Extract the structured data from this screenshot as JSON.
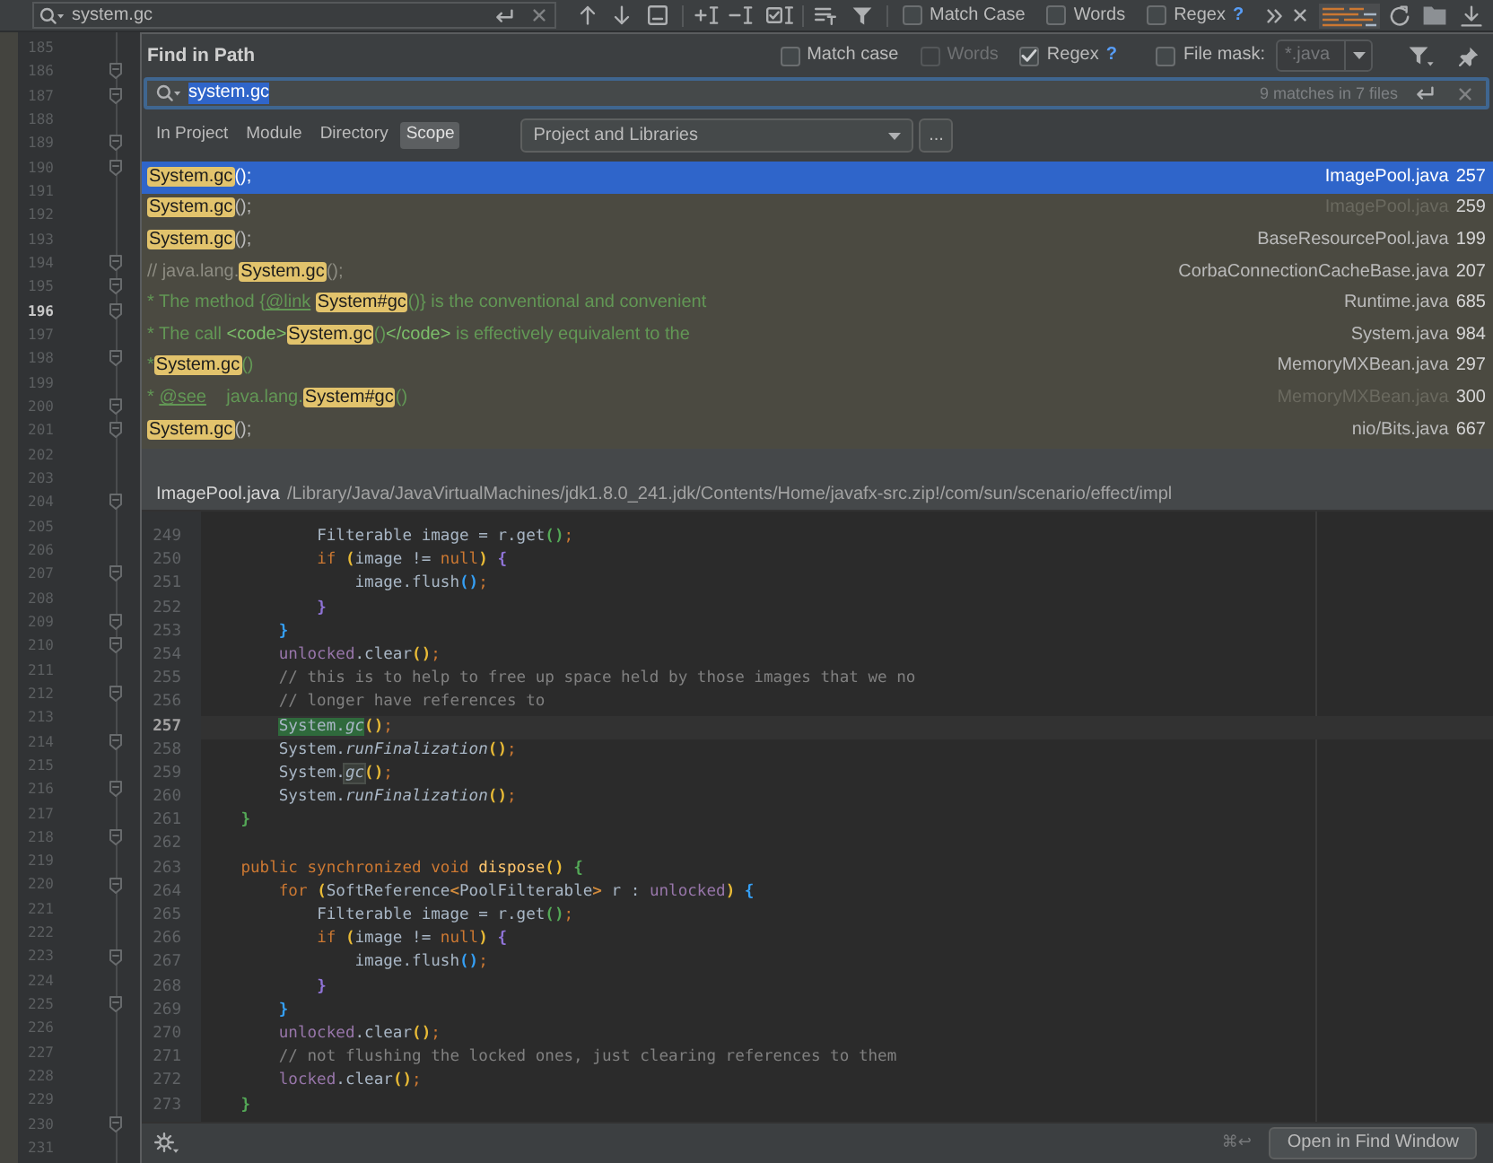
{
  "find_bar": {
    "query": "system.gc",
    "options": [
      {
        "label": "Match Case",
        "checked": false
      },
      {
        "label": "Words",
        "checked": false
      },
      {
        "label": "Regex",
        "checked": false,
        "help": "?"
      }
    ]
  },
  "editor_gutter": {
    "lines": [
      {
        "number": "185",
        "current": false,
        "fold": false
      },
      {
        "number": "186",
        "current": false,
        "fold": true
      },
      {
        "number": "187",
        "current": false,
        "fold": true
      },
      {
        "number": "188",
        "current": false,
        "fold": false
      },
      {
        "number": "189",
        "current": false,
        "fold": true
      },
      {
        "number": "190",
        "current": false,
        "fold": true
      },
      {
        "number": "191",
        "current": false,
        "fold": false
      },
      {
        "number": "192",
        "current": false,
        "fold": false
      },
      {
        "number": "193",
        "current": false,
        "fold": false
      },
      {
        "number": "194",
        "current": false,
        "fold": true
      },
      {
        "number": "195",
        "current": false,
        "fold": true
      },
      {
        "number": "196",
        "current": true,
        "fold": true
      },
      {
        "number": "197",
        "current": false,
        "fold": false
      },
      {
        "number": "198",
        "current": false,
        "fold": true
      },
      {
        "number": "199",
        "current": false,
        "fold": false
      },
      {
        "number": "200",
        "current": false,
        "fold": true
      },
      {
        "number": "201",
        "current": false,
        "fold": true
      },
      {
        "number": "202",
        "current": false,
        "fold": false
      },
      {
        "number": "203",
        "current": false,
        "fold": false
      },
      {
        "number": "204",
        "current": false,
        "fold": true
      },
      {
        "number": "205",
        "current": false,
        "fold": false
      },
      {
        "number": "206",
        "current": false,
        "fold": false
      },
      {
        "number": "207",
        "current": false,
        "fold": true
      },
      {
        "number": "208",
        "current": false,
        "fold": false
      },
      {
        "number": "209",
        "current": false,
        "fold": true
      },
      {
        "number": "210",
        "current": false,
        "fold": true
      },
      {
        "number": "211",
        "current": false,
        "fold": false
      },
      {
        "number": "212",
        "current": false,
        "fold": true
      },
      {
        "number": "213",
        "current": false,
        "fold": false
      },
      {
        "number": "214",
        "current": false,
        "fold": true
      },
      {
        "number": "215",
        "current": false,
        "fold": false
      },
      {
        "number": "216",
        "current": false,
        "fold": true
      },
      {
        "number": "217",
        "current": false,
        "fold": false
      },
      {
        "number": "218",
        "current": false,
        "fold": true
      },
      {
        "number": "219",
        "current": false,
        "fold": false
      },
      {
        "number": "220",
        "current": false,
        "fold": true
      },
      {
        "number": "221",
        "current": false,
        "fold": false
      },
      {
        "number": "222",
        "current": false,
        "fold": false
      },
      {
        "number": "223",
        "current": false,
        "fold": true
      },
      {
        "number": "224",
        "current": false,
        "fold": false
      },
      {
        "number": "225",
        "current": false,
        "fold": true
      },
      {
        "number": "226",
        "current": false,
        "fold": false
      },
      {
        "number": "227",
        "current": false,
        "fold": false
      },
      {
        "number": "228",
        "current": false,
        "fold": false
      },
      {
        "number": "229",
        "current": false,
        "fold": false
      },
      {
        "number": "230",
        "current": false,
        "fold": true
      },
      {
        "number": "231",
        "current": false,
        "fold": false
      }
    ]
  },
  "dialog": {
    "title": "Find in Path",
    "options": [
      {
        "label": "Match case",
        "checked": false,
        "disabled": false
      },
      {
        "label": "Words",
        "checked": false,
        "disabled": true
      },
      {
        "label": "Regex",
        "checked": true,
        "disabled": false,
        "help": "?"
      }
    ],
    "file_mask": {
      "label": "File mask:",
      "checked": false,
      "value": "*.java"
    },
    "search": {
      "query": "system.gc",
      "summary": "9 matches in 7 files"
    },
    "scope_tabs": [
      {
        "label": "In Project",
        "selected": false
      },
      {
        "label": "Module",
        "selected": false
      },
      {
        "label": "Directory",
        "selected": false
      },
      {
        "label": "Scope",
        "selected": true
      }
    ],
    "scope": "Project and Libraries",
    "browse_button": "...",
    "results": [
      {
        "segments": [
          {
            "text": "System.gc",
            "kind": "match"
          },
          {
            "text": "();",
            "kind": "code"
          }
        ],
        "file": "ImagePool.java",
        "line": "257",
        "selected": true,
        "file_dimmed": false
      },
      {
        "segments": [
          {
            "text": "System.gc",
            "kind": "match"
          },
          {
            "text": "();",
            "kind": "code"
          }
        ],
        "file": "ImagePool.java",
        "line": "259",
        "selected": false,
        "file_dimmed": true
      },
      {
        "segments": [
          {
            "text": "System.gc",
            "kind": "match"
          },
          {
            "text": "();",
            "kind": "code"
          }
        ],
        "file": "BaseResourcePool.java",
        "line": "199",
        "selected": false,
        "file_dimmed": false
      },
      {
        "segments": [
          {
            "text": "// java.lang.",
            "kind": "comment"
          },
          {
            "text": "System.gc",
            "kind": "match"
          },
          {
            "text": "();",
            "kind": "comment"
          }
        ],
        "file": "CorbaConnectionCacheBase.java",
        "line": "207",
        "selected": false,
        "file_dimmed": false
      },
      {
        "segments": [
          {
            "text": "* The method {",
            "kind": "doc"
          },
          {
            "text": "@link ",
            "kind": "doc_tag"
          },
          {
            "text": "System#gc",
            "kind": "match"
          },
          {
            "text": "()} is the conventional and convenient",
            "kind": "doc"
          }
        ],
        "file": "Runtime.java",
        "line": "685",
        "selected": false,
        "file_dimmed": false
      },
      {
        "segments": [
          {
            "text": "* The call ",
            "kind": "doc"
          },
          {
            "text": "<code>",
            "kind": "doc_markup"
          },
          {
            "text": "System.gc",
            "kind": "match"
          },
          {
            "text": "()",
            "kind": "doc"
          },
          {
            "text": "</code>",
            "kind": "doc_markup"
          },
          {
            "text": " is effectively equivalent to the",
            "kind": "doc"
          }
        ],
        "file": "System.java",
        "line": "984",
        "selected": false,
        "file_dimmed": false
      },
      {
        "segments": [
          {
            "text": "*",
            "kind": "doc"
          },
          {
            "text": "System.gc",
            "kind": "match"
          },
          {
            "text": "()",
            "kind": "doc"
          }
        ],
        "file": "MemoryMXBean.java",
        "line": "297",
        "selected": false,
        "file_dimmed": false
      },
      {
        "segments": [
          {
            "text": "* ",
            "kind": "doc"
          },
          {
            "text": "@see",
            "kind": "doc_tag"
          },
          {
            "text": "    java.lang.",
            "kind": "doc"
          },
          {
            "text": "System#gc",
            "kind": "match"
          },
          {
            "text": "()",
            "kind": "doc"
          }
        ],
        "file": "MemoryMXBean.java",
        "line": "300",
        "selected": false,
        "file_dimmed": true
      },
      {
        "segments": [
          {
            "text": "System.gc",
            "kind": "match"
          },
          {
            "text": "();",
            "kind": "code"
          }
        ],
        "file": "nio/Bits.java",
        "line": "667",
        "selected": false,
        "file_dimmed": false
      }
    ],
    "preview": {
      "file": "ImagePool.java",
      "path": "/Library/Java/JavaVirtualMachines/jdk1.8.0_241.jdk/Contents/Home/javafx-src.zip!/com/sun/scenario/effect/impl",
      "lines": [
        {
          "number": "249",
          "current": false,
          "segments": [
            {
              "text": "            Filterable image = r.get",
              "kind": "plain"
            },
            {
              "text": "()",
              "kind": "bracket",
              "color": "#54a857"
            },
            {
              "text": ";",
              "kind": "punct"
            }
          ]
        },
        {
          "number": "250",
          "current": false,
          "segments": [
            {
              "text": "            if ",
              "kind": "keyword"
            },
            {
              "text": "(",
              "kind": "bracket",
              "color": "#e8ba36"
            },
            {
              "text": "image != ",
              "kind": "plain"
            },
            {
              "text": "null",
              "kind": "keyword"
            },
            {
              "text": ")",
              "kind": "bracket",
              "color": "#e8ba36"
            },
            {
              "text": " {",
              "kind": "bracket",
              "color": "#8f73d6"
            }
          ]
        },
        {
          "number": "251",
          "current": false,
          "segments": [
            {
              "text": "                image.flush",
              "kind": "plain"
            },
            {
              "text": "()",
              "kind": "bracket",
              "color": "#359ff4"
            },
            {
              "text": ";",
              "kind": "punct"
            }
          ]
        },
        {
          "number": "252",
          "current": false,
          "segments": [
            {
              "text": "            }",
              "kind": "bracket",
              "color": "#8f73d6"
            }
          ]
        },
        {
          "number": "253",
          "current": false,
          "segments": [
            {
              "text": "        }",
              "kind": "bracket",
              "color": "#359ff4"
            }
          ]
        },
        {
          "number": "254",
          "current": false,
          "segments": [
            {
              "text": "        unlocked",
              "kind": "field"
            },
            {
              "text": ".clear",
              "kind": "plain"
            },
            {
              "text": "()",
              "kind": "bracket",
              "color": "#e8ba36"
            },
            {
              "text": ";",
              "kind": "punct"
            }
          ]
        },
        {
          "number": "255",
          "current": false,
          "segments": [
            {
              "text": "        // this is to help to free up space held by those images that we no",
              "kind": "comment"
            }
          ]
        },
        {
          "number": "256",
          "current": false,
          "segments": [
            {
              "text": "        // longer have references to",
              "kind": "comment"
            }
          ]
        },
        {
          "number": "257",
          "current": true,
          "segments": [
            {
              "text": "        System.",
              "kind": "hit"
            },
            {
              "text": "gc",
              "kind": "hit_static"
            },
            {
              "text": "()",
              "kind": "bracket",
              "color": "#e8ba36"
            },
            {
              "text": ";",
              "kind": "punct"
            }
          ]
        },
        {
          "number": "258",
          "current": false,
          "segments": [
            {
              "text": "        System.",
              "kind": "plain"
            },
            {
              "text": "runFinalization",
              "kind": "static"
            },
            {
              "text": "()",
              "kind": "bracket",
              "color": "#e8ba36"
            },
            {
              "text": ";",
              "kind": "punct"
            }
          ]
        },
        {
          "number": "259",
          "current": false,
          "segments": [
            {
              "text": "        System.",
              "kind": "plain"
            },
            {
              "text": "gc",
              "kind": "usage_static"
            },
            {
              "text": "()",
              "kind": "bracket",
              "color": "#e8ba36"
            },
            {
              "text": ";",
              "kind": "punct"
            }
          ]
        },
        {
          "number": "260",
          "current": false,
          "segments": [
            {
              "text": "        System.",
              "kind": "plain"
            },
            {
              "text": "runFinalization",
              "kind": "static"
            },
            {
              "text": "()",
              "kind": "bracket",
              "color": "#e8ba36"
            },
            {
              "text": ";",
              "kind": "punct"
            }
          ]
        },
        {
          "number": "261",
          "current": false,
          "segments": [
            {
              "text": "    }",
              "kind": "bracket",
              "color": "#54a857"
            }
          ]
        },
        {
          "number": "262",
          "current": false
        },
        {
          "number": "263",
          "current": false,
          "segments": [
            {
              "text": "    public synchronized void ",
              "kind": "keyword"
            },
            {
              "text": "dispose",
              "kind": "decl"
            },
            {
              "text": "()",
              "kind": "bracket",
              "color": "#e8ba36"
            },
            {
              "text": " {",
              "kind": "bracket",
              "color": "#54a857"
            }
          ]
        },
        {
          "number": "264",
          "current": false,
          "segments": [
            {
              "text": "        for ",
              "kind": "keyword"
            },
            {
              "text": "(",
              "kind": "bracket",
              "color": "#e8ba36"
            },
            {
              "text": "SoftReference",
              "kind": "plain"
            },
            {
              "text": "<",
              "kind": "bracket",
              "color": "#d08a3c"
            },
            {
              "text": "PoolFilterable",
              "kind": "plain"
            },
            {
              "text": ">",
              "kind": "bracket",
              "color": "#d08a3c"
            },
            {
              "text": " r : ",
              "kind": "plain"
            },
            {
              "text": "unlocked",
              "kind": "field"
            },
            {
              "text": ")",
              "kind": "bracket",
              "color": "#e8ba36"
            },
            {
              "text": " {",
              "kind": "bracket",
              "color": "#359ff4"
            }
          ]
        },
        {
          "number": "265",
          "current": false,
          "segments": [
            {
              "text": "            Filterable image = r.get",
              "kind": "plain"
            },
            {
              "text": "()",
              "kind": "bracket",
              "color": "#54a857"
            },
            {
              "text": ";",
              "kind": "punct"
            }
          ]
        },
        {
          "number": "266",
          "current": false,
          "segments": [
            {
              "text": "            if ",
              "kind": "keyword"
            },
            {
              "text": "(",
              "kind": "bracket",
              "color": "#e8ba36"
            },
            {
              "text": "image != ",
              "kind": "plain"
            },
            {
              "text": "null",
              "kind": "keyword"
            },
            {
              "text": ")",
              "kind": "bracket",
              "color": "#e8ba36"
            },
            {
              "text": " {",
              "kind": "bracket",
              "color": "#8f73d6"
            }
          ]
        },
        {
          "number": "267",
          "current": false,
          "segments": [
            {
              "text": "                image.flush",
              "kind": "plain"
            },
            {
              "text": "()",
              "kind": "bracket",
              "color": "#359ff4"
            },
            {
              "text": ";",
              "kind": "punct"
            }
          ]
        },
        {
          "number": "268",
          "current": false,
          "segments": [
            {
              "text": "            }",
              "kind": "bracket",
              "color": "#8f73d6"
            }
          ]
        },
        {
          "number": "269",
          "current": false,
          "segments": [
            {
              "text": "        }",
              "kind": "bracket",
              "color": "#359ff4"
            }
          ]
        },
        {
          "number": "270",
          "current": false,
          "segments": [
            {
              "text": "        unlocked",
              "kind": "field"
            },
            {
              "text": ".clear",
              "kind": "plain"
            },
            {
              "text": "()",
              "kind": "bracket",
              "color": "#e8ba36"
            },
            {
              "text": ";",
              "kind": "punct"
            }
          ]
        },
        {
          "number": "271",
          "current": false,
          "segments": [
            {
              "text": "        // not flushing the locked ones, just clearing references to them",
              "kind": "comment"
            }
          ]
        },
        {
          "number": "272",
          "current": false,
          "segments": [
            {
              "text": "        locked",
              "kind": "field"
            },
            {
              "text": ".clear",
              "kind": "plain"
            },
            {
              "text": "()",
              "kind": "bracket",
              "color": "#e8ba36"
            },
            {
              "text": ";",
              "kind": "punct"
            }
          ]
        },
        {
          "number": "273",
          "current": false,
          "segments": [
            {
              "text": "    }",
              "kind": "bracket",
              "color": "#54a857"
            }
          ]
        }
      ]
    },
    "footer": {
      "shortcut": "⌘↩",
      "button": "Open in Find Window"
    }
  }
}
